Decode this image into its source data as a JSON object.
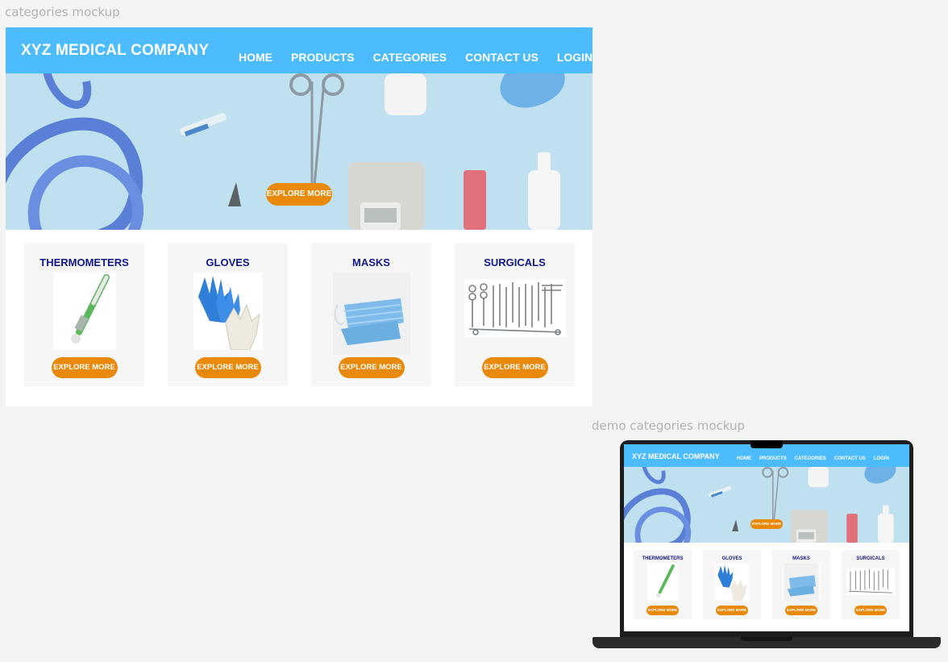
{
  "frames": {
    "main_label": "categories mockup",
    "demo_label": "demo categories mockup"
  },
  "header": {
    "brand": "XYZ MEDICAL COMPANY",
    "nav": [
      "HOME",
      "PRODUCTS",
      "CATEGORIES",
      "CONTACT US",
      "LOGIN"
    ]
  },
  "hero": {
    "button_label": "EXPLORE MORE",
    "image": "medical-equipment-photo"
  },
  "categories": [
    {
      "title": "THERMOMETERS",
      "button": "EXPLORE MORE",
      "image": "thermometer-image"
    },
    {
      "title": "GLOVES",
      "button": "EXPLORE MORE",
      "image": "gloves-image"
    },
    {
      "title": "MASKS",
      "button": "EXPLORE MORE",
      "image": "masks-image"
    },
    {
      "title": "SURGICALS",
      "button": "EXPLORE MORE",
      "image": "surgical-tools-image"
    }
  ],
  "colors": {
    "nav_bg": "#4cbcff",
    "button_bg": "#e8890a",
    "category_title": "#10188a",
    "card_bg": "#f6f6f6",
    "hero_bg": "#bfe0ef"
  }
}
